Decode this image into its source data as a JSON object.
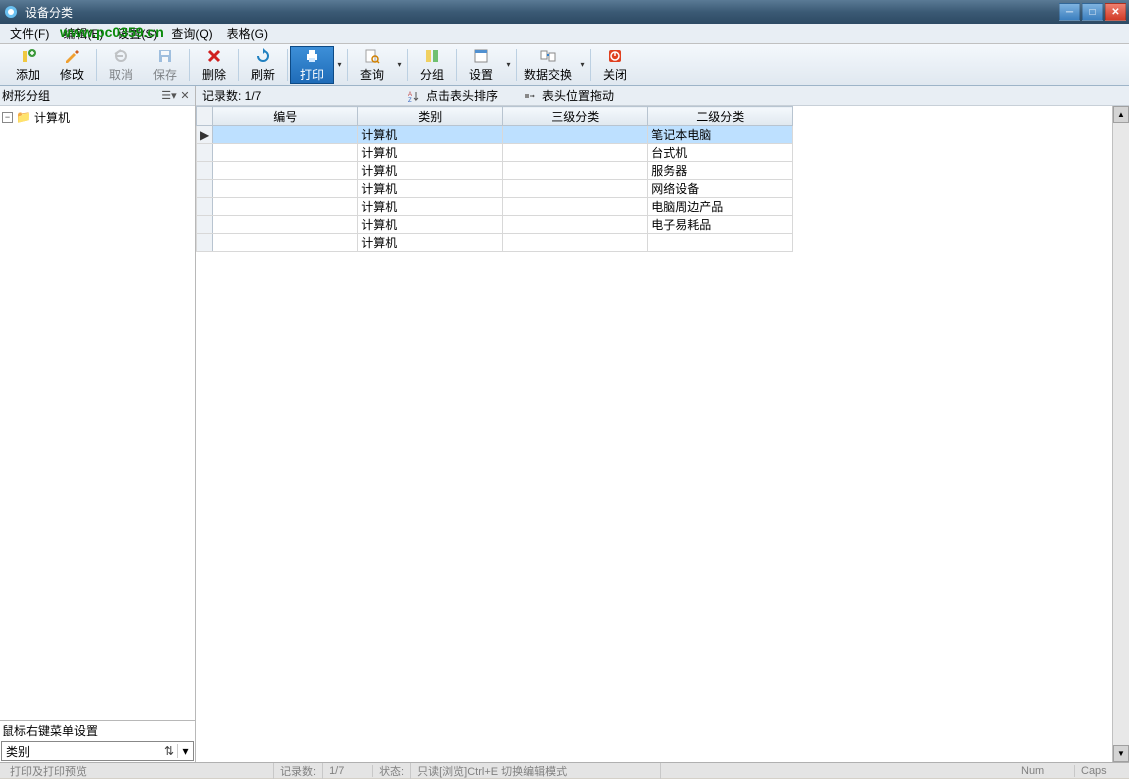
{
  "window": {
    "title": "设备分类"
  },
  "menu": {
    "items": [
      {
        "label": "文件(F)"
      },
      {
        "label": "编辑(E)"
      },
      {
        "label": "设置(S)"
      },
      {
        "label": "查询(Q)"
      },
      {
        "label": "表格(G)"
      }
    ]
  },
  "watermark": "www.pc0359.cn",
  "toolbar": {
    "add": "添加",
    "edit": "修改",
    "cancel": "取消",
    "save": "保存",
    "delete": "删除",
    "refresh": "刷新",
    "print": "打印",
    "query": "查询",
    "group": "分组",
    "settings": "设置",
    "exchange": "数据交换",
    "close": "关闭",
    "dropdown": "▾"
  },
  "sidebar": {
    "title": "树形分组",
    "root": "计算机",
    "bottom_label": "鼠标右键菜单设置",
    "combo_value": "类别"
  },
  "infobar": {
    "records": "记录数: 1/7",
    "sort_hint": "点击表头排序",
    "drag_hint": "表头位置拖动"
  },
  "table": {
    "headers": [
      "编号",
      "类别",
      "三级分类",
      "二级分类"
    ],
    "rows": [
      {
        "num": "",
        "cat": "计算机",
        "l3": "",
        "l2": "笔记本电脑",
        "sel": true
      },
      {
        "num": "",
        "cat": "计算机",
        "l3": "",
        "l2": "台式机"
      },
      {
        "num": "",
        "cat": "计算机",
        "l3": "",
        "l2": "服务器"
      },
      {
        "num": "",
        "cat": "计算机",
        "l3": "",
        "l2": "网络设备"
      },
      {
        "num": "",
        "cat": "计算机",
        "l3": "",
        "l2": "电脑周边产品"
      },
      {
        "num": "",
        "cat": "计算机",
        "l3": "",
        "l2": "电子易耗品"
      },
      {
        "num": "",
        "cat": "计算机",
        "l3": "",
        "l2": ""
      }
    ]
  },
  "status": {
    "hint": "打印及打印预览",
    "rec1": "记录数:",
    "rec2": "1/7",
    "state": "状态:",
    "readonly": "只读[浏览]Ctrl+E 切换编辑模式",
    "num": "Num",
    "caps": "Caps"
  }
}
